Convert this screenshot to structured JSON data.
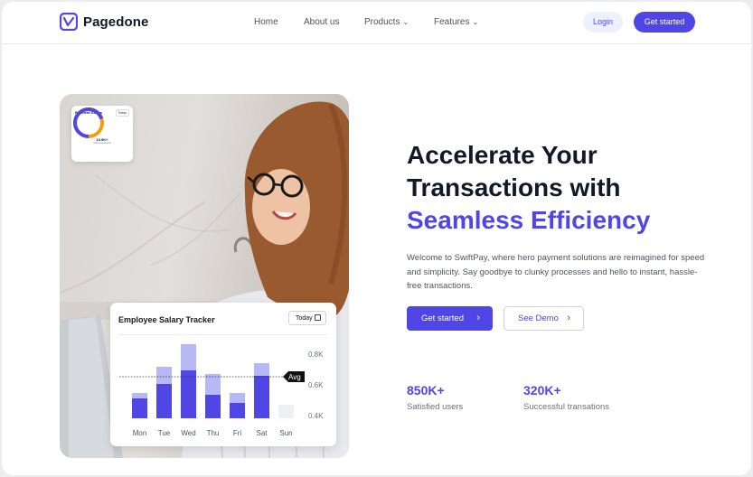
{
  "brand": {
    "name": "Pagedone",
    "color": "#4f46e5"
  },
  "nav": {
    "items": [
      {
        "label": "Home"
      },
      {
        "label": "About us"
      },
      {
        "label": "Products",
        "dropdown": true
      },
      {
        "label": "Features",
        "dropdown": true
      }
    ],
    "login_label": "Login",
    "get_started_label": "Get started"
  },
  "hero": {
    "headline_line1": "Accelerate Your",
    "headline_line2": "Transactions with",
    "headline_accent": "Seamless Efficiency",
    "description": "Welcome to SwiftPay, where hero payment solutions are reimagined for speed and simplicity. Say goodbye to clunky processes and hello to instant, hassle-free transactions.",
    "primary_cta": "Get started",
    "secondary_cta": "See Demo",
    "stats": [
      {
        "value": "850K+",
        "label": "Satisfied users"
      },
      {
        "value": "320K+",
        "label": "Successful transations"
      }
    ]
  },
  "payment_card": {
    "title": "Payment Status",
    "filter": "Today",
    "value": "10.5K+",
    "subtitle": "Total of payments"
  },
  "salary_tracker": {
    "title": "Employee Salary Tracker",
    "filter": "Today",
    "avg_label": "Avg",
    "y_ticks": [
      "0.8K",
      "0.6K",
      "0.4K"
    ],
    "days": [
      "Mon",
      "Tue",
      "Wed",
      "Thu",
      "Fri",
      "Sat",
      "Sun"
    ],
    "colors": {
      "primary": "#4f46e5",
      "secondary": "#b7b9f7",
      "empty": "#eef0f3"
    }
  }
}
